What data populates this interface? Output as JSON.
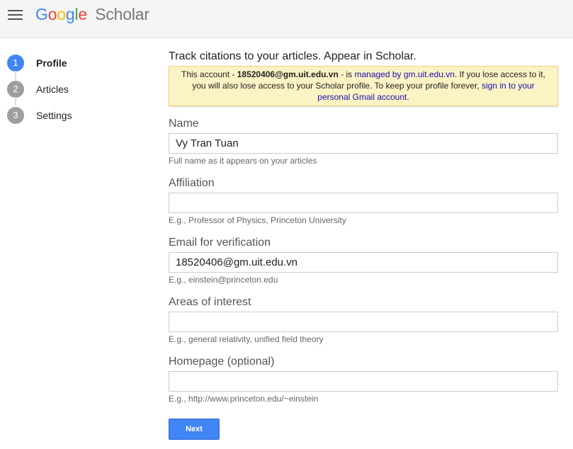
{
  "header": {
    "logo_google_letters": [
      "G",
      "o",
      "o",
      "g",
      "l",
      "e"
    ],
    "logo_google_colors": [
      "#4285f4",
      "#ea4335",
      "#fbbc05",
      "#4285f4",
      "#34a853",
      "#ea4335"
    ],
    "logo_scholar": "Scholar",
    "menu_icon": "hamburger-menu-icon"
  },
  "steps": [
    {
      "num": "1",
      "label": "Profile",
      "active": true
    },
    {
      "num": "2",
      "label": "Articles",
      "active": false
    },
    {
      "num": "3",
      "label": "Settings",
      "active": false
    }
  ],
  "main": {
    "intro": "Track citations to your articles. Appear in Scholar.",
    "notice": {
      "prefix": "This account - ",
      "email": "18520406@gm.uit.edu.vn",
      "mid": " - is ",
      "managed_link": "managed by gm.uit.edu.vn",
      "after_managed": ". If you lose access to it, you will also lose access to your Scholar profile. To keep your profile forever, ",
      "signin_link": "sign in to your personal Gmail account",
      "suffix": "."
    },
    "fields": [
      {
        "label": "Name",
        "value": "Vy Tran Tuan",
        "hint": "Full name as it appears on your articles"
      },
      {
        "label": "Affiliation",
        "value": "",
        "hint": "E.g., Professor of Physics, Princeton University"
      },
      {
        "label": "Email for verification",
        "value": "18520406@gm.uit.edu.vn",
        "hint": "E.g., einstein@princeton.edu"
      },
      {
        "label": "Areas of interest",
        "value": "",
        "hint": "E.g., general relativity, unified field theory"
      },
      {
        "label": "Homepage (optional)",
        "value": "",
        "hint": "E.g., http://www.princeton.edu/~einstein"
      }
    ],
    "next_label": "Next"
  },
  "colors": {
    "accent": "#4285f4",
    "notice_bg": "#fcf3c5",
    "link": "#1a0dab"
  }
}
